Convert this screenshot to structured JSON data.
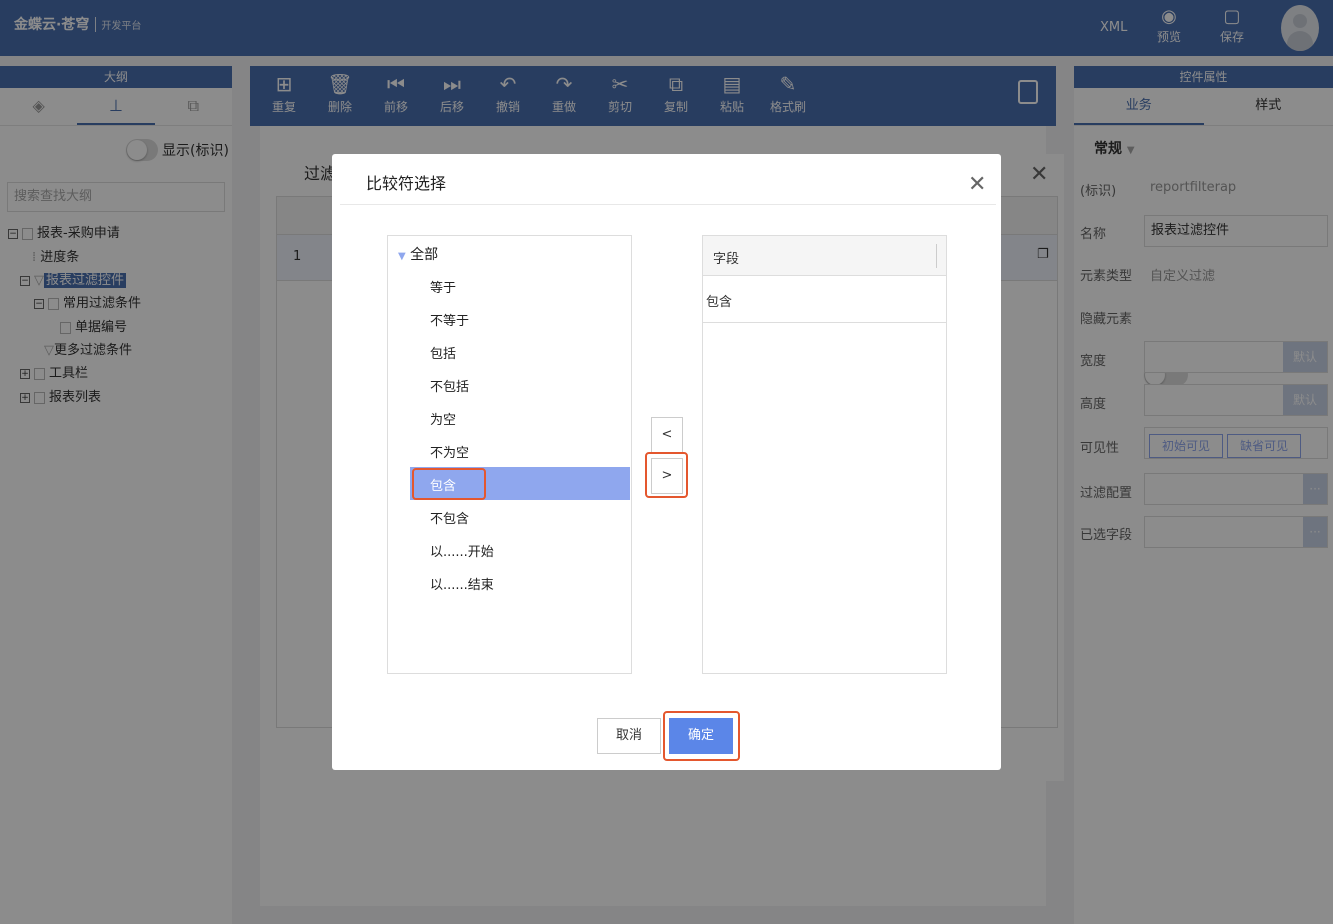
{
  "topbar": {
    "logo_text": "金蝶云·苍穹",
    "logo_sub": "开发平台",
    "xml_label": "XML",
    "preview_label": "预览",
    "save_label": "保存"
  },
  "left_panel": {
    "header": "大纲",
    "show_label": "显示(标识)",
    "search_placeholder": "搜索查找大纲",
    "tree": [
      {
        "label": "报表-采购申请"
      },
      {
        "label": "进度条"
      },
      {
        "label": "报表过滤控件"
      },
      {
        "label": "常用过滤条件"
      },
      {
        "label": "单据编号"
      },
      {
        "label": "更多过滤条件"
      },
      {
        "label": "工具栏"
      },
      {
        "label": "报表列表"
      }
    ]
  },
  "toolbar": {
    "items": [
      {
        "label": "重复",
        "icon": "duplicate-icon"
      },
      {
        "label": "删除",
        "icon": "trash-icon"
      },
      {
        "label": "前移",
        "icon": "move-forward-icon"
      },
      {
        "label": "后移",
        "icon": "move-back-icon"
      },
      {
        "label": "撤销",
        "icon": "undo-icon"
      },
      {
        "label": "重做",
        "icon": "redo-icon"
      },
      {
        "label": "剪切",
        "icon": "cut-icon"
      },
      {
        "label": "复制",
        "icon": "copy-icon"
      },
      {
        "label": "粘贴",
        "icon": "paste-icon"
      },
      {
        "label": "格式刷",
        "icon": "format-brush-icon"
      }
    ]
  },
  "right_panel": {
    "header": "控件属性",
    "tabs": [
      "业务",
      "样式"
    ],
    "section": "常规",
    "props": {
      "id_label": "(标识)",
      "id_value": "reportfilterap",
      "name_label": "名称",
      "name_value": "报表过滤控件",
      "type_label": "元素类型",
      "type_value": "自定义过滤",
      "hidden_label": "隐藏元素",
      "width_label": "宽度",
      "height_label": "高度",
      "default_label": "默认",
      "visible_label": "可见性",
      "visible_initial": "初始可见",
      "visible_default": "缺省可见",
      "filter_config_label": "过滤配置",
      "selected_fields_label": "已选字段"
    }
  },
  "back_dialog": {
    "title": "过滤",
    "row_no": "1"
  },
  "dialog": {
    "title": "比较符选择",
    "all_label": "全部",
    "operators": [
      "等于",
      "不等于",
      "包括",
      "不包括",
      "为空",
      "不为空",
      "包含",
      "不包含",
      "以......开始",
      "以......结束"
    ],
    "selected_operator": "包含",
    "right_header": "字段",
    "right_value": "包含",
    "move_left": "<",
    "move_right": ">",
    "cancel": "取消",
    "ok": "确定"
  }
}
